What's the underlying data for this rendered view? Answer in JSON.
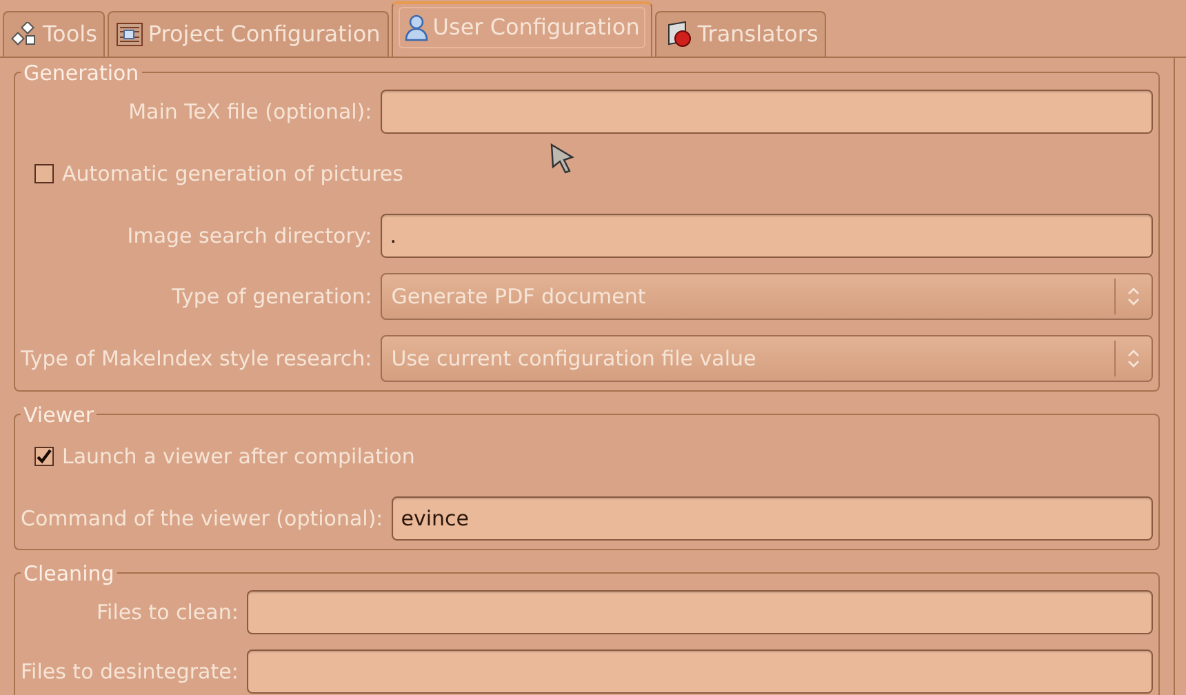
{
  "tabs": [
    {
      "label": "Tools",
      "selected": false
    },
    {
      "label": "Project Configuration",
      "selected": false
    },
    {
      "label": "User Configuration",
      "selected": true
    },
    {
      "label": "Translators",
      "selected": false
    }
  ],
  "groups": [
    {
      "title": "Generation",
      "rows": [
        {
          "kind": "text",
          "label": "Main TeX file (optional):",
          "value": ""
        },
        {
          "kind": "checkbox",
          "text": "Automatic generation of pictures",
          "checked": false
        },
        {
          "kind": "text",
          "label": "Image search directory:",
          "value": "."
        },
        {
          "kind": "combo",
          "label": "Type of generation:",
          "value": "Generate PDF document"
        },
        {
          "kind": "combo",
          "label": "Type of MakeIndex style research:",
          "value": "Use current configuration file value"
        }
      ]
    },
    {
      "title": "Viewer",
      "rows": [
        {
          "kind": "checkbox",
          "text": "Launch a viewer after compilation",
          "checked": true
        },
        {
          "kind": "text",
          "label": "Command of the viewer (optional):",
          "value": "evince"
        }
      ]
    },
    {
      "title": "Cleaning",
      "rows": [
        {
          "kind": "text",
          "label": "Files to clean:",
          "value": ""
        },
        {
          "kind": "text",
          "label": "Files to desintegrate:",
          "value": ""
        }
      ]
    }
  ]
}
